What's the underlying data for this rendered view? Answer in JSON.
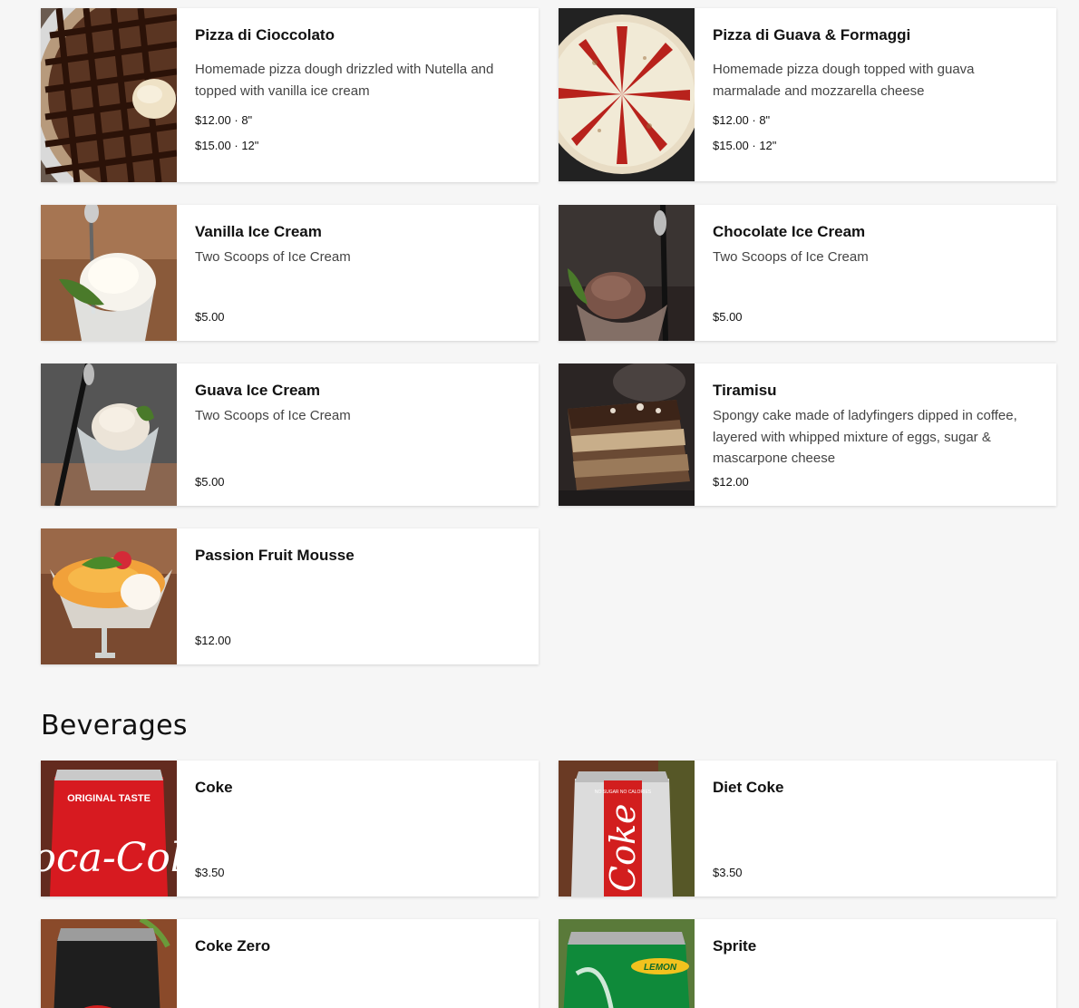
{
  "desserts": {
    "cioccolato": {
      "name": "Pizza di Cioccolato",
      "description": "Homemade pizza dough drizzled with Nutella and topped with vanilla ice cream",
      "prices": [
        "$12.00 · 8\"",
        "$15.00 · 12\""
      ]
    },
    "guava_formaggi": {
      "name": "Pizza di Guava & Formaggi",
      "description": "Homemade pizza dough topped with guava marmalade and mozzarella cheese",
      "prices": [
        "$12.00 · 8\"",
        "$15.00 · 12\""
      ]
    },
    "vanilla": {
      "name": "Vanilla Ice Cream",
      "description": "Two Scoops of Ice Cream",
      "price": "$5.00"
    },
    "chocolate": {
      "name": "Chocolate Ice Cream",
      "description": "Two Scoops of Ice Cream",
      "price": "$5.00"
    },
    "guava_ice": {
      "name": "Guava Ice Cream",
      "description": "Two Scoops of Ice Cream",
      "price": "$5.00"
    },
    "tiramisu": {
      "name": "Tiramisu",
      "description": "Spongy cake made of ladyfingers dipped in coffee, layered with whipped mixture of eggs, sugar & mascarpone cheese",
      "price": "$12.00"
    },
    "passion": {
      "name": "Passion Fruit Mousse",
      "price": "$12.00"
    }
  },
  "beverages": {
    "title": "Beverages",
    "coke": {
      "name": "Coke",
      "price": "$3.50"
    },
    "diet_coke": {
      "name": "Diet Coke",
      "price": "$3.50"
    },
    "coke_zero": {
      "name": "Coke Zero"
    },
    "sprite": {
      "name": "Sprite"
    }
  },
  "can_labels": {
    "coke": "Coca-Cola",
    "coke_top": "ORIGINAL TASTE",
    "diet_coke": "Coke",
    "diet_coke_top": "NO SUGAR NO CALORIES",
    "sprite": "LEMON"
  }
}
